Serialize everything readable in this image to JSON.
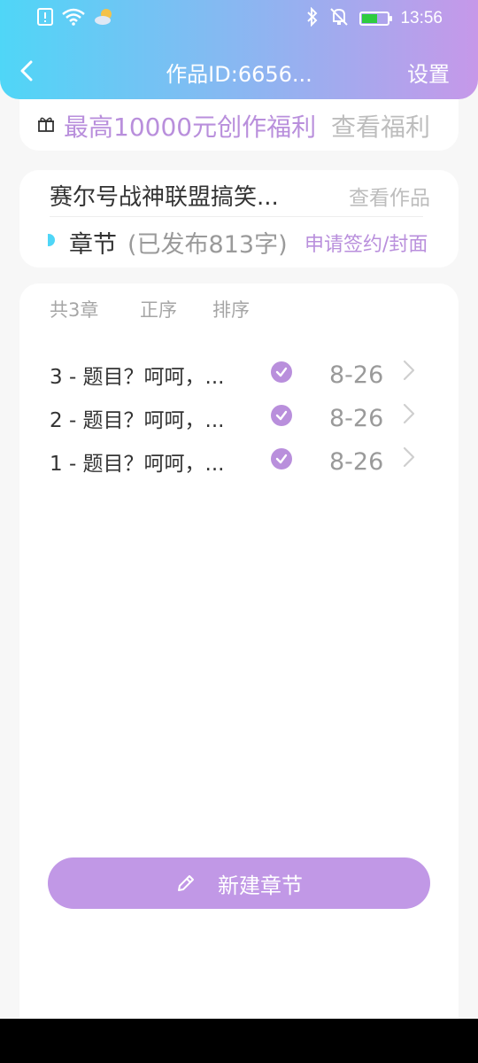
{
  "status_bar": {
    "time": "13:56",
    "icons": [
      "alert-icon",
      "wifi-icon",
      "weather-icon",
      "bluetooth-icon",
      "mute-icon",
      "battery-icon"
    ]
  },
  "nav": {
    "title": "作品ID:6656...",
    "settings_label": "设置"
  },
  "benefit": {
    "text": "最高10000元创作福利",
    "link_label": "查看福利"
  },
  "work": {
    "title": "赛尔号战神联盟搞笑...",
    "view_label": "查看作品",
    "chapter_label": "章节",
    "published_text": "(已发布813字)",
    "apply_label": "申请签约/封面"
  },
  "list": {
    "count_label": "共3章",
    "order_label": "正序",
    "sort_label": "排序",
    "chapters": [
      {
        "title": "3 - 题目？呵呵，...",
        "date": "8-26",
        "status": "published"
      },
      {
        "title": "2 - 题目？呵呵，...",
        "date": "8-26",
        "status": "published"
      },
      {
        "title": "1 - 题目？呵呵，...",
        "date": "8-26",
        "status": "published"
      }
    ]
  },
  "actions": {
    "new_chapter_label": "新建章节"
  },
  "colors": {
    "accent_purple": "#b98fdc",
    "accent_cyan": "#4fd6f7",
    "button_purple": "#c198e6"
  }
}
